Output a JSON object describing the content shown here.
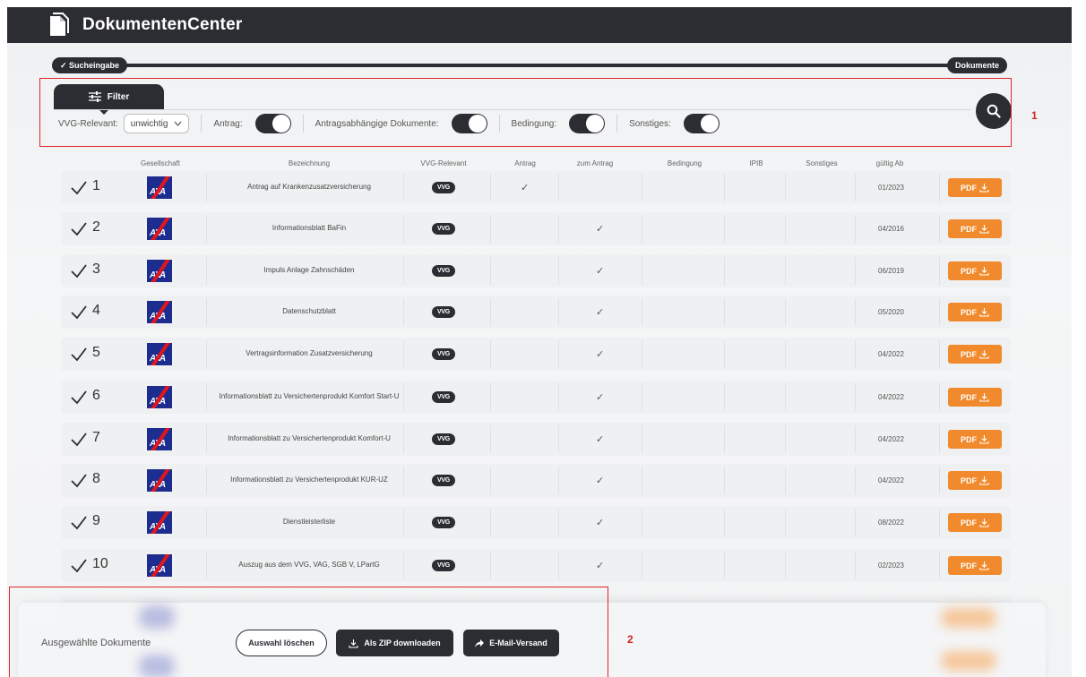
{
  "app": {
    "title": "DokumentenCenter"
  },
  "stepper": {
    "left_label": "✓ Sucheingabe",
    "right_label": "Dokumente"
  },
  "filter": {
    "tab_label": "Filter",
    "vvg_label": "VVG-Relevant:",
    "vvg_value": "unwichtig",
    "antrag_label": "Antrag:",
    "antragsabh_label": "Antragsabhängige Dokumente:",
    "bedingung_label": "Bedingung:",
    "sonstiges_label": "Sonstiges:"
  },
  "table": {
    "headers": [
      "Gesellschaft",
      "Bezeichnung",
      "VVG-Relevant",
      "Antrag",
      "zum Antrag",
      "Bedingung",
      "IPIB",
      "Sonstiges",
      "gültig Ab"
    ],
    "rows": [
      {
        "num": "1",
        "bez": "Antrag auf Krankenzusatzversicherung",
        "vvg": "VVG",
        "antrag": true,
        "zum_antrag": false,
        "date": "01/2023",
        "pdf": "PDF"
      },
      {
        "num": "2",
        "bez": "Informationsblatt BaFin",
        "vvg": "VVG",
        "antrag": false,
        "zum_antrag": true,
        "date": "04/2016",
        "pdf": "PDF"
      },
      {
        "num": "3",
        "bez": "Impuls Anlage Zahnschäden",
        "vvg": "VVG",
        "antrag": false,
        "zum_antrag": true,
        "date": "06/2019",
        "pdf": "PDF"
      },
      {
        "num": "4",
        "bez": "Datenschutzblatt",
        "vvg": "VVG",
        "antrag": false,
        "zum_antrag": true,
        "date": "05/2020",
        "pdf": "PDF"
      },
      {
        "num": "5",
        "bez": "Vertragsinformation Zusatzversicherung",
        "vvg": "VVG",
        "antrag": false,
        "zum_antrag": true,
        "date": "04/2022",
        "pdf": "PDF"
      },
      {
        "num": "6",
        "bez": "Informationsblatt zu Versichertenprodukt Komfort Start-U",
        "vvg": "VVG",
        "antrag": false,
        "zum_antrag": true,
        "date": "04/2022",
        "pdf": "PDF"
      },
      {
        "num": "7",
        "bez": "Informationsblatt zu Versichertenprodukt Komfort-U",
        "vvg": "VVG",
        "antrag": false,
        "zum_antrag": true,
        "date": "04/2022",
        "pdf": "PDF"
      },
      {
        "num": "8",
        "bez": "Informationsblatt zu Versichertenprodukt KUR-UZ",
        "vvg": "VVG",
        "antrag": false,
        "zum_antrag": true,
        "date": "04/2022",
        "pdf": "PDF"
      },
      {
        "num": "9",
        "bez": "Dienstleisterliste",
        "vvg": "VVG",
        "antrag": false,
        "zum_antrag": true,
        "date": "08/2022",
        "pdf": "PDF"
      },
      {
        "num": "10",
        "bez": "Auszug aus dem VVG, VAG, SGB V, LPartG",
        "vvg": "VVG",
        "antrag": false,
        "zum_antrag": true,
        "date": "02/2023",
        "pdf": "PDF"
      }
    ],
    "check_glyph": "✓"
  },
  "actions": {
    "label": "Ausgewählte Dokumente",
    "clear": "Auswahl löschen",
    "zip": "Als ZIP downloaden",
    "mail": "E-Mail-Versand"
  },
  "annotations": {
    "box1": "1",
    "box2": "2"
  },
  "colors": {
    "dark": "#2b2d33",
    "accent": "#f08a2c",
    "axa_blue": "#1c2d8f",
    "axa_red": "#e3151d",
    "annotation": "#e0262b"
  },
  "icons": [
    "document-icon",
    "sliders-icon",
    "chevron-down-icon",
    "search-icon",
    "checkbox-checked-icon",
    "download-icon",
    "share-arrow-icon"
  ]
}
